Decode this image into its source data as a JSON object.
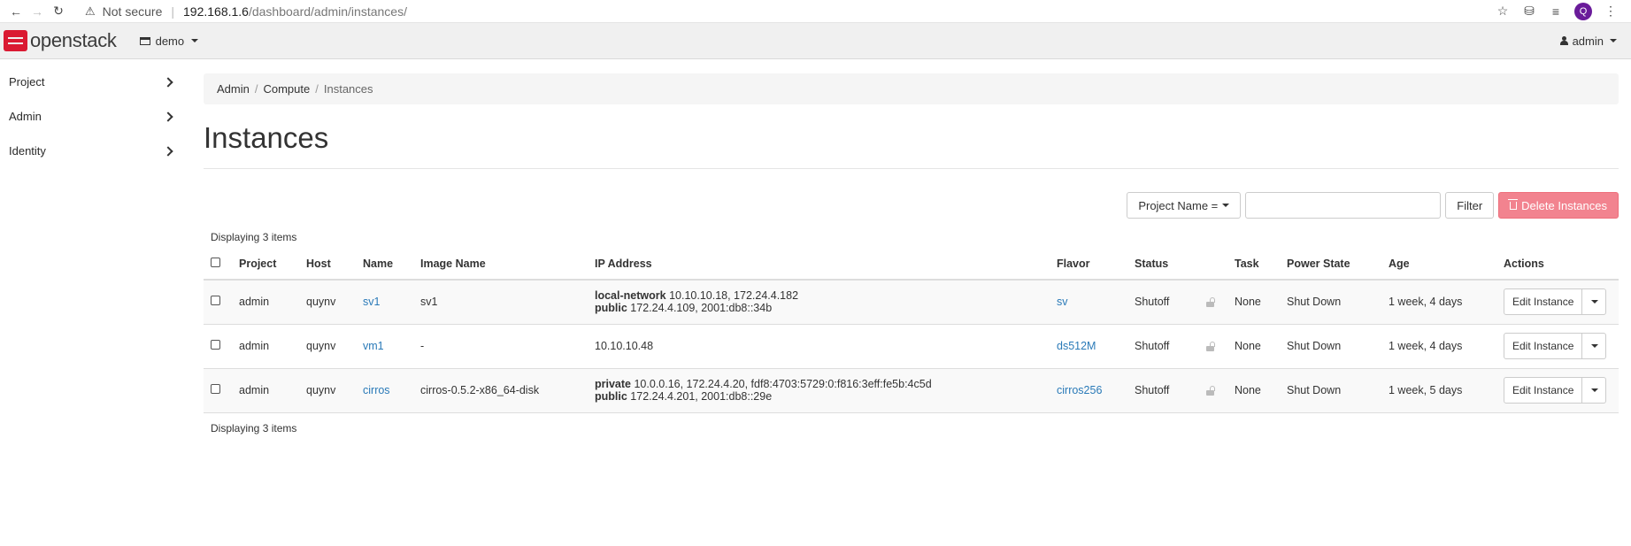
{
  "browser": {
    "security_label": "Not secure",
    "url_host": "192.168.1.6",
    "url_path": "/dashboard/admin/instances/",
    "profile_initial": "Q"
  },
  "topnav": {
    "logo_text": "openstack",
    "project_selector": "demo",
    "user_menu": "admin"
  },
  "sidebar": {
    "items": [
      {
        "label": "Project"
      },
      {
        "label": "Admin"
      },
      {
        "label": "Identity"
      }
    ]
  },
  "breadcrumb": {
    "items": [
      "Admin",
      "Compute",
      "Instances"
    ]
  },
  "page": {
    "title": "Instances"
  },
  "filter": {
    "field_select": "Project Name =",
    "input_value": "",
    "filter_button": "Filter",
    "delete_button": "Delete Instances"
  },
  "table": {
    "display_count": "Displaying 3 items",
    "headers": [
      "Project",
      "Host",
      "Name",
      "Image Name",
      "IP Address",
      "Flavor",
      "Status",
      "Task",
      "Power State",
      "Age",
      "Actions"
    ],
    "rows": [
      {
        "project": "admin",
        "host": "quynv",
        "name": "sv1",
        "image": "sv1",
        "ip": [
          {
            "network": "local-network",
            "addrs": "10.10.10.18, 172.24.4.182"
          },
          {
            "network": "public",
            "addrs": "172.24.4.109, 2001:db8::34b"
          }
        ],
        "flavor": "sv",
        "status": "Shutoff",
        "task": "None",
        "power": "Shut Down",
        "age": "1 week, 4 days",
        "action": "Edit Instance"
      },
      {
        "project": "admin",
        "host": "quynv",
        "name": "vm1",
        "image": "-",
        "ip_plain": "10.10.10.48",
        "flavor": "ds512M",
        "status": "Shutoff",
        "task": "None",
        "power": "Shut Down",
        "age": "1 week, 4 days",
        "action": "Edit Instance"
      },
      {
        "project": "admin",
        "host": "quynv",
        "name": "cirros",
        "image": "cirros-0.5.2-x86_64-disk",
        "ip": [
          {
            "network": "private",
            "addrs": "10.0.0.16, 172.24.4.20, fdf8:4703:5729:0:f816:3eff:fe5b:4c5d"
          },
          {
            "network": "public",
            "addrs": "172.24.4.201, 2001:db8::29e"
          }
        ],
        "flavor": "cirros256",
        "status": "Shutoff",
        "task": "None",
        "power": "Shut Down",
        "age": "1 week, 5 days",
        "action": "Edit Instance"
      }
    ]
  },
  "colors": {
    "brand_red": "#da1a32",
    "link_blue": "#2a7ab8",
    "danger_button": "#f2838f"
  }
}
